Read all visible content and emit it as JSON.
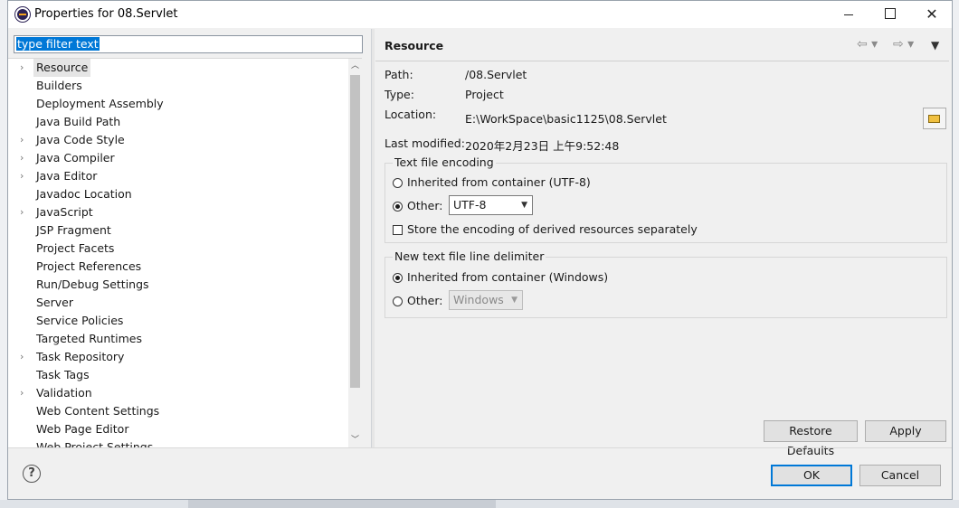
{
  "window": {
    "title": "Properties for 08.Servlet",
    "minimize": "–",
    "close": "✕"
  },
  "filter": {
    "placeholder": "type filter text"
  },
  "tree": [
    {
      "label": "Resource",
      "expandable": true,
      "selected": true
    },
    {
      "label": "Builders",
      "expandable": false
    },
    {
      "label": "Deployment Assembly",
      "expandable": false
    },
    {
      "label": "Java Build Path",
      "expandable": false
    },
    {
      "label": "Java Code Style",
      "expandable": true
    },
    {
      "label": "Java Compiler",
      "expandable": true
    },
    {
      "label": "Java Editor",
      "expandable": true
    },
    {
      "label": "Javadoc Location",
      "expandable": false
    },
    {
      "label": "JavaScript",
      "expandable": true
    },
    {
      "label": "JSP Fragment",
      "expandable": false
    },
    {
      "label": "Project Facets",
      "expandable": false
    },
    {
      "label": "Project References",
      "expandable": false
    },
    {
      "label": "Run/Debug Settings",
      "expandable": false
    },
    {
      "label": "Server",
      "expandable": false
    },
    {
      "label": "Service Policies",
      "expandable": false
    },
    {
      "label": "Targeted Runtimes",
      "expandable": false
    },
    {
      "label": "Task Repository",
      "expandable": true
    },
    {
      "label": "Task Tags",
      "expandable": false
    },
    {
      "label": "Validation",
      "expandable": true
    },
    {
      "label": "Web Content Settings",
      "expandable": false
    },
    {
      "label": "Web Page Editor",
      "expandable": false
    },
    {
      "label": "Web Project Settings",
      "expandable": false
    }
  ],
  "resource": {
    "title": "Resource",
    "path_label": "Path:",
    "path_value": "/08.Servlet",
    "type_label": "Type:",
    "type_value": "Project",
    "location_label": "Location:",
    "location_value": "E:\\WorkSpace\\basic1125\\08.Servlet",
    "modified_label": "Last modified:",
    "modified_value": "2020年2月23日 上午9:52:48",
    "encoding_group": "Text file encoding",
    "encoding_inherited": "Inherited from container (UTF-8)",
    "encoding_other": "Other:",
    "encoding_value": "UTF-8",
    "encoding_derived": "Store the encoding of derived resources separately",
    "delimiter_group": "New text file line delimiter",
    "delimiter_inherited": "Inherited from container (Windows)",
    "delimiter_other": "Other:",
    "delimiter_value": "Windows",
    "encoding_selection": "other",
    "delimiter_selection": "inherited"
  },
  "buttons": {
    "restore": "Restore Defaults",
    "apply": "Apply",
    "ok": "OK",
    "cancel": "Cancel",
    "help": "?"
  },
  "colors": {
    "accent": "#0078d7",
    "selection_bg": "#e5e5e5"
  },
  "icons": [
    "eclipse-icon",
    "back-arrow-icon",
    "forward-arrow-icon",
    "view-menu-icon",
    "folder-open-icon",
    "help-icon"
  ]
}
